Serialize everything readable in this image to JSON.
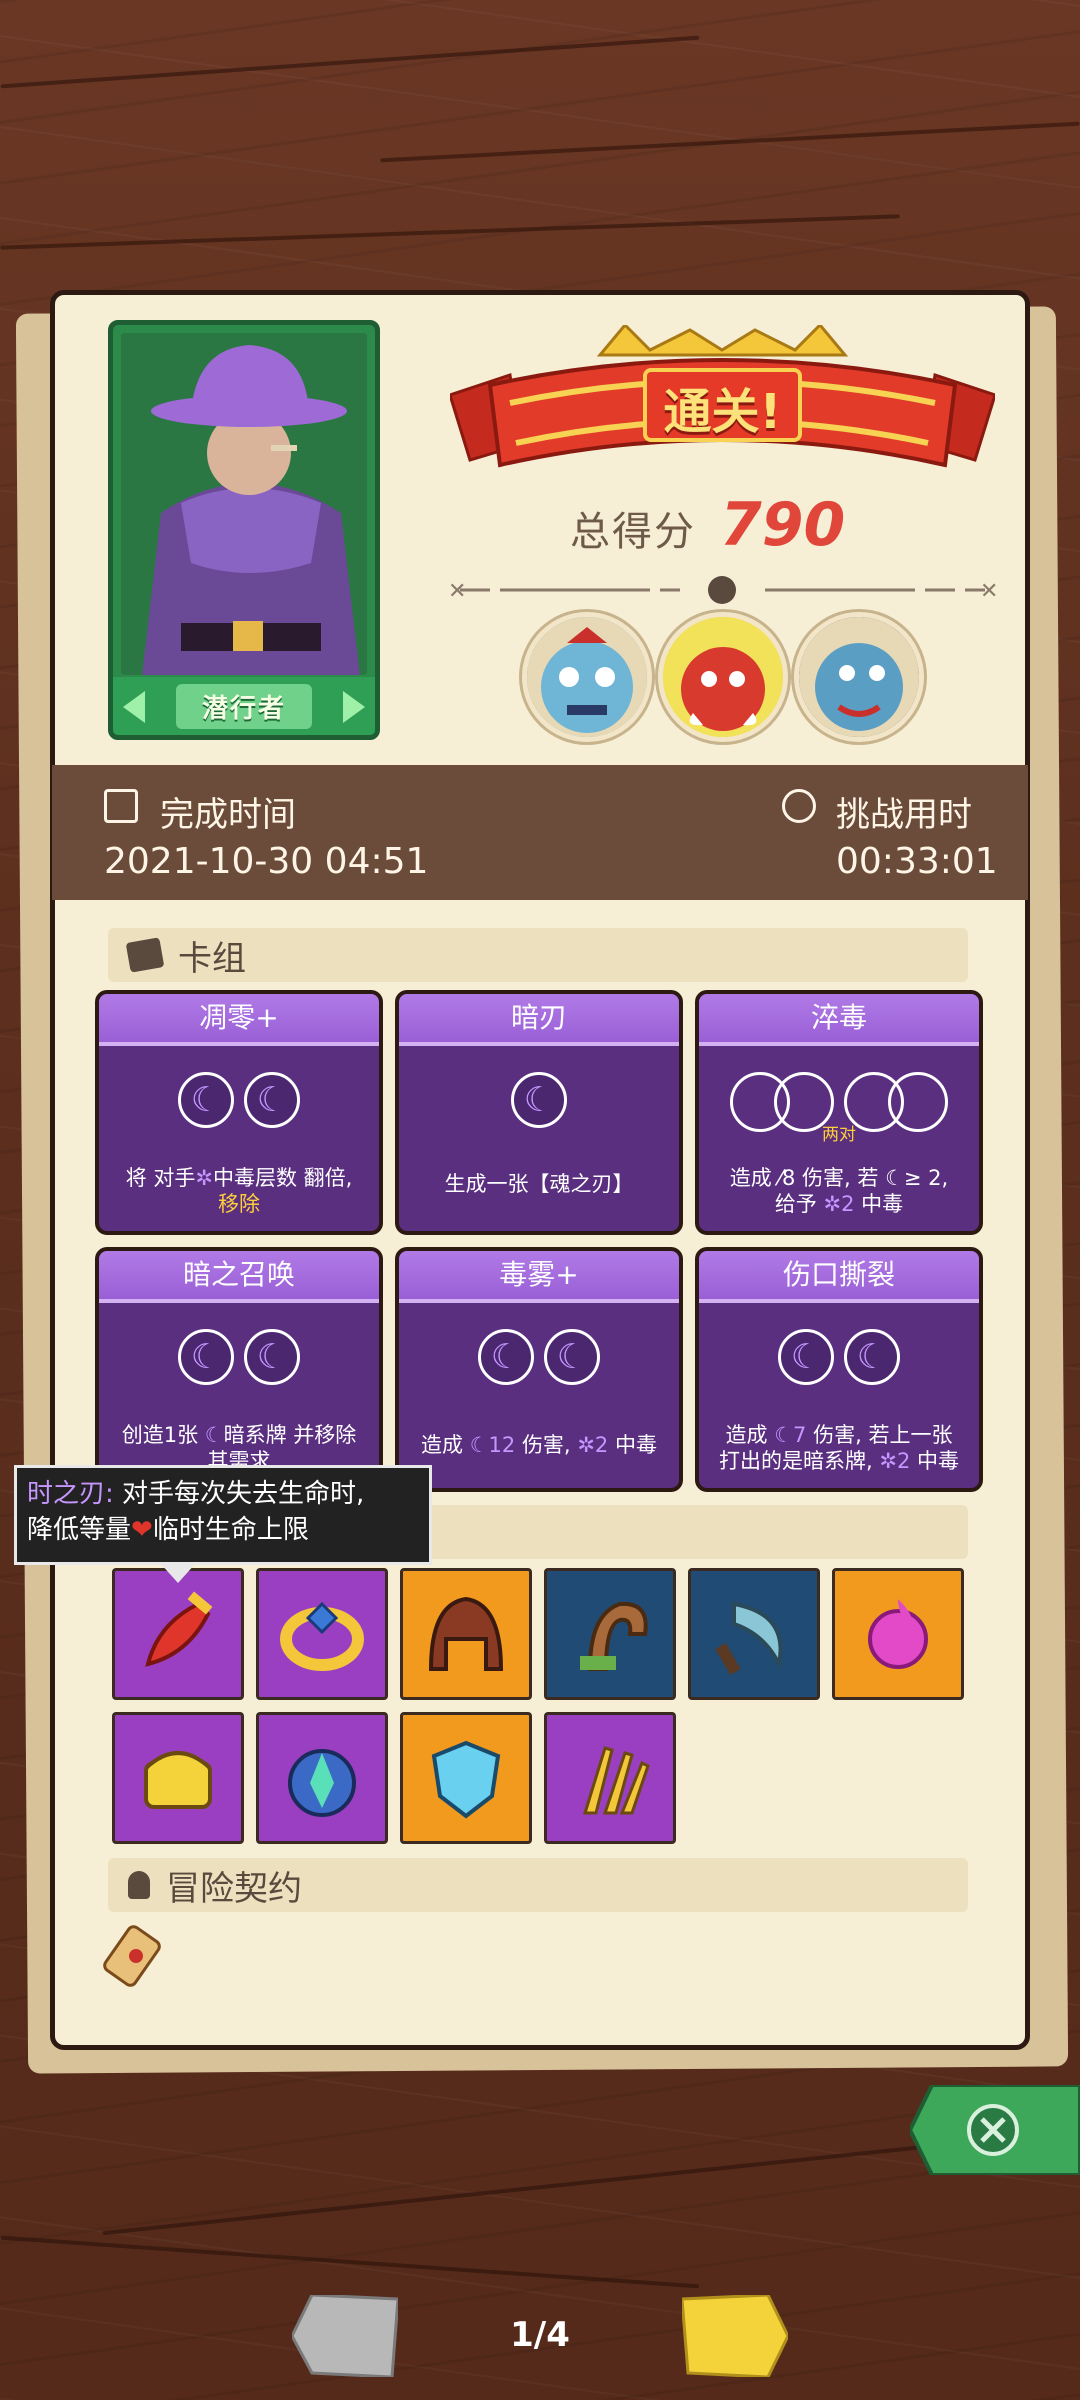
{
  "header": {
    "result_banner": "通关!",
    "total_score_label": "总得分",
    "total_score": "790"
  },
  "hero": {
    "name": "潜行者"
  },
  "run_info": {
    "complete_time_label": "完成时间",
    "complete_time": "2021-10-30 04:51",
    "challenge_time_label": "挑战用时",
    "challenge_time": "00:33:01"
  },
  "deck": {
    "title": "卡组",
    "cards": [
      {
        "name": "凋零+",
        "desc_a": "将 对手",
        "desc_b": "中毒层数 翻倍,",
        "desc_c": "移除"
      },
      {
        "name": "暗刃",
        "desc_a": "生成一张【魂之刃】"
      },
      {
        "name": "淬毒",
        "sub": "两对",
        "desc_a": "造成",
        "desc_num": "8",
        "desc_b": "伤害, 若",
        "desc_c": "≥ 2,",
        "desc_d": "给予",
        "desc_num2": "2",
        "desc_e": "中毒"
      },
      {
        "name": "暗之召唤",
        "desc_a": "创造1张",
        "desc_b": "暗系牌 并移除",
        "desc_c": "其需求"
      },
      {
        "name": "毒雾+",
        "desc_a": "造成",
        "desc_num": "12",
        "desc_b": "伤害,",
        "desc_num2": "2",
        "desc_c": "中毒"
      },
      {
        "name": "伤口撕裂",
        "desc_a": "造成",
        "desc_num": "7",
        "desc_b": "伤害, 若上一张",
        "desc_c": "打出的是暗系牌,",
        "desc_num2": "2",
        "desc_d": "中毒"
      }
    ]
  },
  "relics": {
    "items": [
      {
        "icon": "red-dagger-icon",
        "color": "purple"
      },
      {
        "icon": "gold-ring-icon",
        "color": "purple"
      },
      {
        "icon": "helmet-icon",
        "color": "orange"
      },
      {
        "icon": "horn-icon",
        "color": "blue"
      },
      {
        "icon": "sickle-icon",
        "color": "blue"
      },
      {
        "icon": "fire-orb-icon",
        "color": "orange"
      },
      {
        "icon": "golden-box-icon",
        "color": "purple"
      },
      {
        "icon": "crystal-monster-icon",
        "color": "purple"
      },
      {
        "icon": "blue-shield-icon",
        "color": "orange"
      },
      {
        "icon": "claw-icon",
        "color": "purple"
      }
    ]
  },
  "tooltip": {
    "name": "时之刃:",
    "line1": " 对手每次失去生命时,",
    "line2a": "降低等量",
    "line2b": "临时生命上限"
  },
  "contract": {
    "title": "冒险契约"
  },
  "pager": {
    "text": "1/4"
  },
  "colors": {
    "card_purple": "#5a2f80",
    "score_red": "#e0463a",
    "hero_green": "#2c8a4a"
  }
}
